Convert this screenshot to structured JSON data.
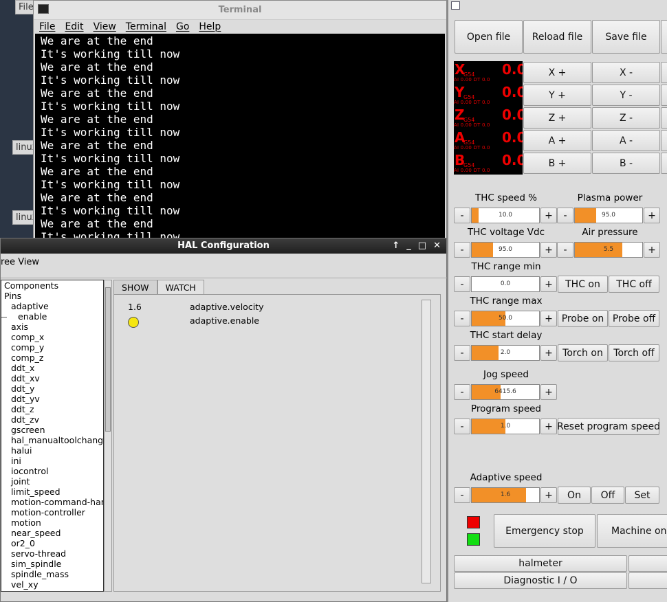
{
  "desktop": {
    "file_label": "File",
    "linux_labels": [
      "linux",
      "linux"
    ]
  },
  "terminal": {
    "title": "Terminal",
    "menu": [
      "File",
      "Edit",
      "View",
      "Terminal",
      "Go",
      "Help"
    ],
    "lines": [
      "We are at the end",
      "It's working till now",
      "We are at the end",
      "It's working till now",
      "We are at the end",
      "It's working till now",
      "We are at the end",
      "It's working till now",
      "We are at the end",
      "It's working till now",
      "We are at the end",
      "It's working till now",
      "We are at the end",
      "It's working till now",
      "We are at the end",
      "It's working till now"
    ]
  },
  "hal": {
    "title": "HAL Configuration",
    "controls": [
      "↑",
      "_",
      "□",
      "✕"
    ],
    "tree_view_label": "ree View",
    "tree": [
      {
        "text": "Components",
        "indent": 4
      },
      {
        "text": "Pins",
        "indent": 4
      },
      {
        "text": "adaptive",
        "indent": 14
      },
      {
        "text": "enable",
        "indent": 24,
        "dash": true
      },
      {
        "text": "axis",
        "indent": 14
      },
      {
        "text": "comp_x",
        "indent": 14
      },
      {
        "text": "comp_y",
        "indent": 14
      },
      {
        "text": "comp_z",
        "indent": 14
      },
      {
        "text": "ddt_x",
        "indent": 14
      },
      {
        "text": "ddt_xv",
        "indent": 14
      },
      {
        "text": "ddt_y",
        "indent": 14
      },
      {
        "text": "ddt_yv",
        "indent": 14
      },
      {
        "text": "ddt_z",
        "indent": 14
      },
      {
        "text": "ddt_zv",
        "indent": 14
      },
      {
        "text": "gscreen",
        "indent": 14
      },
      {
        "text": "hal_manualtoolchange",
        "indent": 14
      },
      {
        "text": "halui",
        "indent": 14
      },
      {
        "text": "ini",
        "indent": 14
      },
      {
        "text": "iocontrol",
        "indent": 14
      },
      {
        "text": "joint",
        "indent": 14
      },
      {
        "text": "limit_speed",
        "indent": 14
      },
      {
        "text": "motion-command-handler",
        "indent": 14
      },
      {
        "text": "motion-controller",
        "indent": 14
      },
      {
        "text": "motion",
        "indent": 14
      },
      {
        "text": "near_speed",
        "indent": 14
      },
      {
        "text": "or2_0",
        "indent": 14
      },
      {
        "text": "servo-thread",
        "indent": 14
      },
      {
        "text": "sim_spindle",
        "indent": 14
      },
      {
        "text": "spindle_mass",
        "indent": 14
      },
      {
        "text": "vel_xy",
        "indent": 14
      }
    ],
    "tabs": [
      "SHOW",
      "WATCH"
    ],
    "watch": [
      {
        "value": "1.6",
        "name": "adaptive.velocity"
      },
      {
        "value": "",
        "name": "adaptive.enable",
        "led_color": "#f5e611"
      }
    ]
  },
  "panel": {
    "file_buttons": [
      "Open file",
      "Reload file",
      "Save file"
    ],
    "dro": [
      {
        "axis": "X",
        "coord": "G54",
        "value": "0.0",
        "sub": "AI      0.00 DT     0.0"
      },
      {
        "axis": "Y",
        "coord": "G54",
        "value": "0.0",
        "sub": "AI      0.00 DT     0.0"
      },
      {
        "axis": "Z",
        "coord": "G54",
        "value": "0.0",
        "sub": "AI      0.00 DT     0.0"
      },
      {
        "axis": "A",
        "coord": "G54",
        "value": "0.0",
        "sub": "AI      0.00 DT     0.0"
      },
      {
        "axis": "B",
        "coord": "G54",
        "value": "0.0",
        "sub": "AI      0.00 DT     0.0"
      }
    ],
    "jog_buttons": [
      [
        "X +",
        "X -"
      ],
      [
        "Y +",
        "Y -"
      ],
      [
        "Z +",
        "Z -"
      ],
      [
        "A +",
        "A -"
      ],
      [
        "B +",
        "B -"
      ]
    ],
    "spin_minus": "-",
    "spin_plus": "+",
    "thc_speed": {
      "label": "THC speed %",
      "value": "10.0",
      "level": 0.1
    },
    "plasma_power": {
      "label": "Plasma power",
      "value": "95.0",
      "level": 0.32
    },
    "thc_voltage": {
      "label": "THC voltage Vdc",
      "value": "95.0",
      "level": 0.32
    },
    "air_pressure": {
      "label": "Air pressure",
      "value": "5.5",
      "level": 0.7
    },
    "thc_range_min": {
      "label": "THC range min",
      "value": "0.0",
      "level": 0
    },
    "thc_range_max": {
      "label": "THC range max",
      "value": "50.0",
      "level": 0.5
    },
    "thc_start_delay": {
      "label": "THC start delay",
      "value": "2.0",
      "level": 0.4
    },
    "jog_speed": {
      "label": "Jog speed",
      "value": "6415.6",
      "level": 0.43
    },
    "program_speed": {
      "label": "Program speed",
      "value": "1.0",
      "level": 0.5
    },
    "adaptive_speed": {
      "label": "Adaptive speed",
      "value": "1.6",
      "level": 0.81
    },
    "thc_on": "THC on",
    "thc_off": "THC off",
    "probe_on": "Probe on",
    "probe_off": "Probe off",
    "torch_on": "Torch on",
    "torch_off": "Torch off",
    "reset_program_speed": "Reset program speed",
    "adaptive_on": "On",
    "adaptive_off": "Off",
    "adaptive_set": "Set",
    "emergency_stop": "Emergency stop",
    "machine_on": "Machine on",
    "estop_indicator_color": "#ee0000",
    "machine_indicator_color": "#11dd11",
    "halmeter": "halmeter",
    "diagnostic_io": "Diagnostic I / O"
  }
}
